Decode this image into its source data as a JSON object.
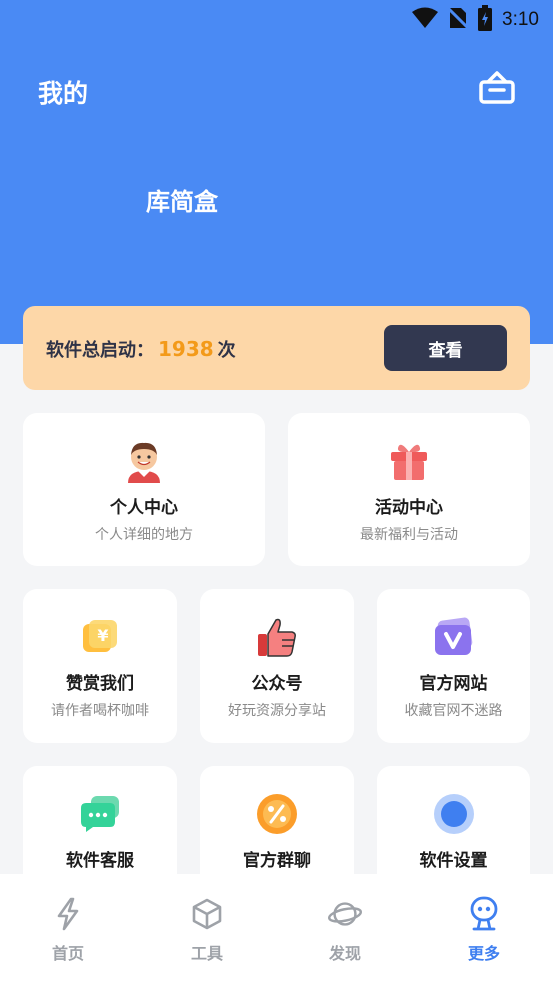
{
  "status_bar": {
    "time": "3:10"
  },
  "header": {
    "title": "我的",
    "app_name": "库简盒"
  },
  "launch": {
    "label": "软件总启动：",
    "count": "1938",
    "unit": "次",
    "button_label": "查看"
  },
  "colors": {
    "header_bg": "#4a8af4",
    "accent": "#3f7ff0",
    "launch_bg": "#fdd7a8",
    "count": "#f39a1a"
  },
  "big_cards": [
    {
      "title": "个人中心",
      "subtitle": "个人详细的地方",
      "icon": "avatar-icon"
    },
    {
      "title": "活动中心",
      "subtitle": "最新福利与活动",
      "icon": "gift-icon"
    }
  ],
  "grid_cards": [
    {
      "title": "赞赏我们",
      "subtitle": "请作者喝杯咖啡",
      "icon": "yen-icon"
    },
    {
      "title": "公众号",
      "subtitle": "好玩资源分享站",
      "icon": "thumbs-up-icon"
    },
    {
      "title": "官方网站",
      "subtitle": "收藏官网不迷路",
      "icon": "website-v-icon"
    },
    {
      "title": "软件客服",
      "subtitle": "",
      "icon": "chat-icon"
    },
    {
      "title": "官方群聊",
      "subtitle": "",
      "icon": "percent-icon"
    },
    {
      "title": "软件设置",
      "subtitle": "",
      "icon": "settings-dot-icon"
    }
  ],
  "tabs": [
    {
      "label": "首页",
      "icon": "lightning-icon"
    },
    {
      "label": "工具",
      "icon": "cube-icon"
    },
    {
      "label": "发现",
      "icon": "planet-icon"
    },
    {
      "label": "更多",
      "icon": "robot-icon",
      "active": true
    }
  ]
}
